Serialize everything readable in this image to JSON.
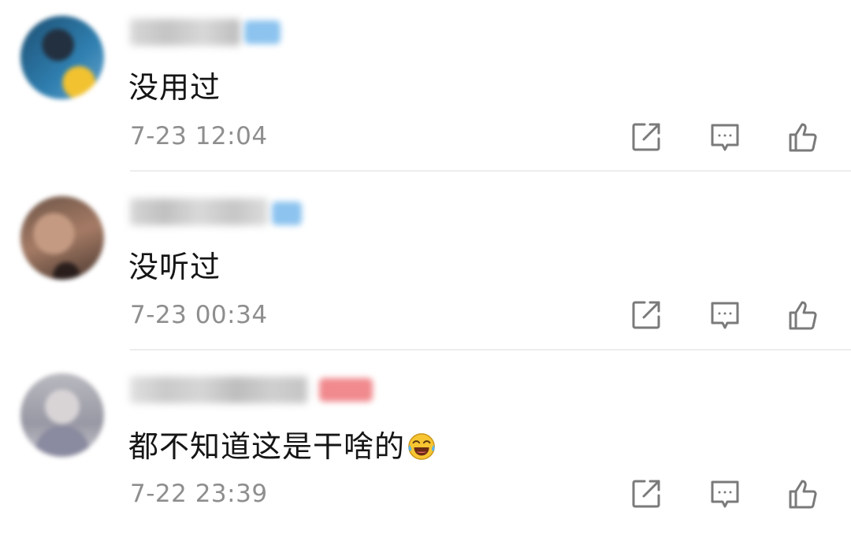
{
  "comments": [
    {
      "text": "没用过",
      "time": "7-23 12:04",
      "avatar_colors": [
        "#1d4f73",
        "#2f7fb0",
        "#f2c230"
      ],
      "badge_color": "#8cc3ef"
    },
    {
      "text": "没听过",
      "time": "7-23 00:34",
      "avatar_colors": [
        "#8a6552",
        "#c49a82",
        "#3a2c28"
      ],
      "badge_color": "#8cc3ef"
    },
    {
      "text": "都不知道这是干啥的",
      "time": "7-22 23:39",
      "avatar_colors": [
        "#9a9aa8",
        "#c8c8d0",
        "#6d6d7c"
      ],
      "badge_color": "#f08a8e"
    }
  ],
  "icons": {
    "share": "share-icon",
    "reply": "comment-icon",
    "like": "thumbs-up-icon",
    "emoji": "laughing-crying-emoji-icon"
  },
  "colors": {
    "text": "#151515",
    "time": "#8e8e8e",
    "icon": "#7a7a7a",
    "divider": "#ededed"
  }
}
